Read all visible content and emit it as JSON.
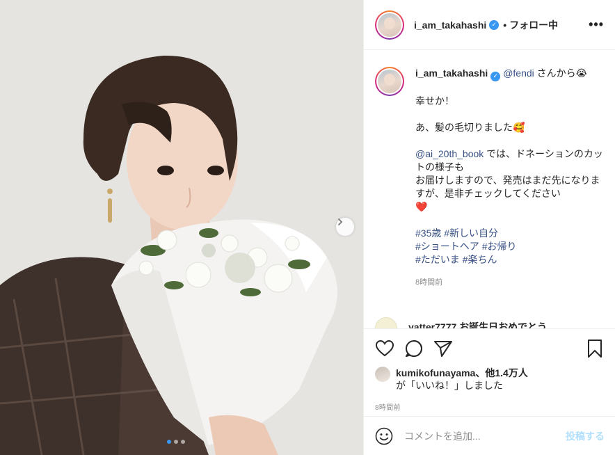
{
  "post": {
    "username": "i_am_takahashi",
    "follow_status": "• フォロー中",
    "more_label": "•••"
  },
  "caption": {
    "username": "i_am_takahashi",
    "mention_fendi": "@fendi",
    "line1_rest": " さんから😭",
    "line2": "幸せか！",
    "line3": "あ、髪の毛切りました🥰",
    "mention_book": "@ai_20th_book",
    "line4_rest": " では、ドネーションのカットの様子も",
    "line5": "お届けしますので、発売はまだ先になりますが、是非チェックしてください",
    "heart": "❤️",
    "hashtags_line1": [
      "#35歳",
      "#新しい自分"
    ],
    "hashtags_line2": [
      "#ショートヘア",
      "#お帰り"
    ],
    "hashtags_line3": [
      "#ただいま",
      "#楽ちん"
    ],
    "time": "8時間前"
  },
  "partial_comment": {
    "text": "yatter7777 お誕生日おめでとう"
  },
  "likes": {
    "user": "kumikofunayama",
    "others": "、他1.4万人",
    "suffix": "が「いいね！」しました"
  },
  "post_time": "8時間前",
  "comment_box": {
    "placeholder": "コメントを追加...",
    "post_label": "投稿する"
  },
  "carousel": {
    "total": 3,
    "active": 1
  },
  "colors": {
    "link": "#385185",
    "muted": "#8e8e8e",
    "active_dot": "#3897f0",
    "post_button_disabled": "#b2dffc"
  }
}
